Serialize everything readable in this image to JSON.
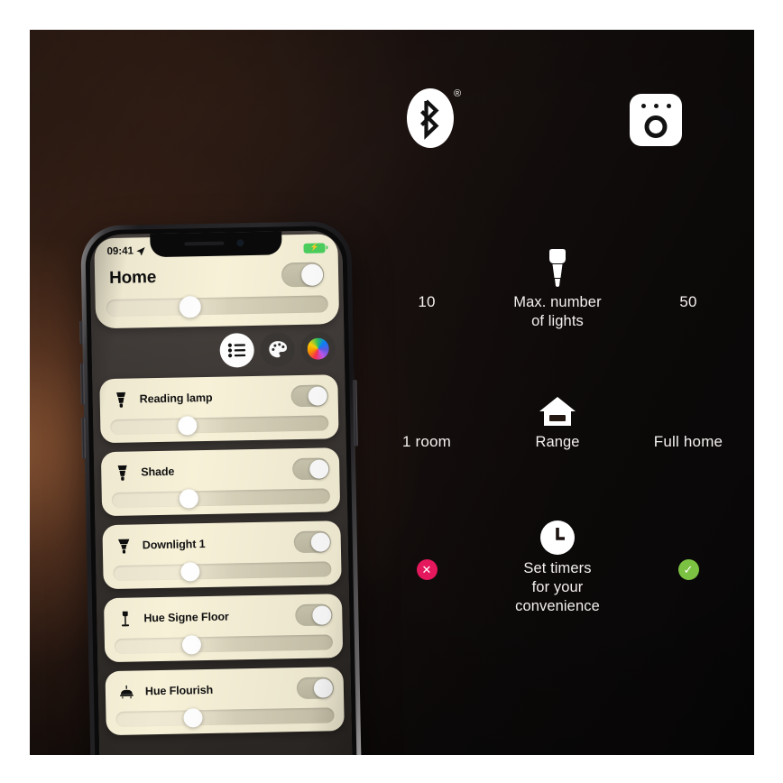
{
  "image": {
    "title": "Philips Hue Bluetooth vs Zigbee comparison",
    "background_accent": "#c47a4a"
  },
  "comparison": {
    "left_logo": {
      "name": "Bluetooth",
      "icon": "bluetooth-icon",
      "trademark": "®"
    },
    "right_logo": {
      "name": "Hue Bridge",
      "icon": "hue-bridge-icon"
    },
    "rows": [
      {
        "id": "max-lights",
        "icon": "light-bulb-icon",
        "label": "Max. number\nof lights",
        "label_line1": "Max. number",
        "label_line2": "of lights",
        "left_value": "10",
        "right_value": "50"
      },
      {
        "id": "range",
        "icon": "house-icon",
        "label": "Range",
        "left_value": "1 room",
        "right_value": "Full home"
      },
      {
        "id": "timers",
        "icon": "clock-icon",
        "label_line1": "Set timers",
        "label_line2": "for your",
        "label_line3": "convenience",
        "left_value": "✕",
        "right_value": "✓",
        "left_badge_color": "#e5175d",
        "right_badge_color": "#7cc242"
      }
    ]
  },
  "phone": {
    "status_bar": {
      "time": "09:41",
      "location_icon": "location-arrow-icon",
      "battery_icon": "battery-charging-icon",
      "battery_bolt": "⚡"
    },
    "home_card": {
      "title": "Home",
      "toggle_state": "on",
      "brightness_percent": 38
    },
    "segmented_controls": [
      {
        "id": "list",
        "icon": "list-icon",
        "active": true
      },
      {
        "id": "scenes",
        "icon": "palette-icon",
        "active": false
      },
      {
        "id": "colors",
        "icon": "hue-color-pin-icon",
        "active": false
      }
    ],
    "lights": [
      {
        "name": "Reading lamp",
        "icon": "spot-bulb-icon",
        "toggle_state": "on",
        "brightness_percent": 36
      },
      {
        "name": "Shade",
        "icon": "spot-bulb-icon",
        "toggle_state": "on",
        "brightness_percent": 36
      },
      {
        "name": "Downlight 1",
        "icon": "downlight-icon",
        "toggle_state": "on",
        "brightness_percent": 36
      },
      {
        "name": "Hue Signe Floor",
        "icon": "floor-lamp-icon",
        "toggle_state": "on",
        "brightness_percent": 36
      },
      {
        "name": "Hue Flourish",
        "icon": "ceiling-lamp-icon",
        "toggle_state": "on",
        "brightness_percent": 36
      }
    ]
  }
}
